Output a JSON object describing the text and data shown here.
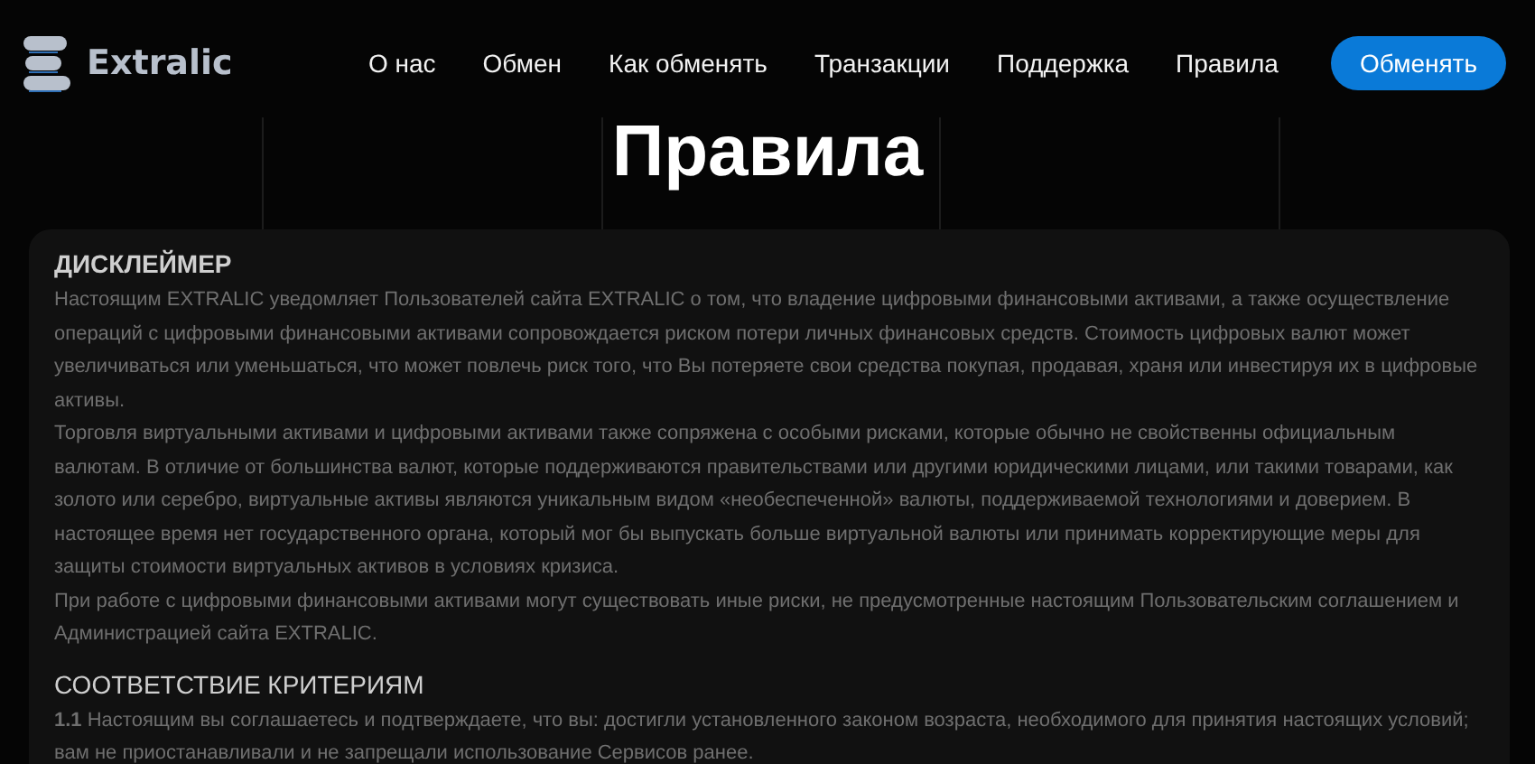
{
  "header": {
    "logo_text": "Extralic",
    "nav": [
      {
        "label": "О нас",
        "selected": false
      },
      {
        "label": "Обмен",
        "selected": false
      },
      {
        "label": "Как обменять",
        "selected": false
      },
      {
        "label": "Транзакции",
        "selected": false
      },
      {
        "label": "Поддержка",
        "selected": false
      },
      {
        "label": "Правила",
        "selected": false
      }
    ],
    "action_button": "Обменять"
  },
  "page_title": "Правила",
  "sections": [
    {
      "heading": "ДИСКЛЕЙМЕР",
      "paragraphs": [
        "Настоящим EXTRALIC уведомляет Пользователей сайта EXTRALIC о том, что владение цифровыми финансовыми активами, а также осуществление операций с цифровыми финансовыми активами сопровождается риском потери личных финансовых средств. Стоимость цифровых валют может увеличиваться или уменьшаться, что может повлечь риск того, что Вы потеряете свои средства покупая, продавая, храня или инвестируя их в цифровые активы.",
        "Торговля виртуальными активами и цифровыми активами также сопряжена с особыми рисками, которые обычно не свойственны официальным валютам. В отличие от большинства валют, которые поддерживаются правительствами или другими юридическими лицами, или такими товарами, как золото или серебро, виртуальные активы являются уникальным видом «необеспеченной» валюты, поддерживаемой технологиями и доверием. В настоящее время нет государственного органа, который мог бы выпускать больше виртуальной валюты или принимать корректирующие меры для защиты стоимости виртуальных активов в условиях кризиса.",
        "При работе с цифровыми финансовыми активами могут существовать иные риски, не предусмотренные настоящим Пользовательским соглашением и Администрацией сайта EXTRALIC."
      ]
    },
    {
      "heading": "СООТВЕТСТВИЕ КРИТЕРИЯМ",
      "paragraphs": [
        "**1.1** Настоящим вы соглашаетесь и подтверждаете, что вы: достигли установленного законом возраста, необходимого для принятия настоящих условий; вам не приостанавливали и не запрещали использование Сервисов ранее."
      ]
    }
  ]
}
